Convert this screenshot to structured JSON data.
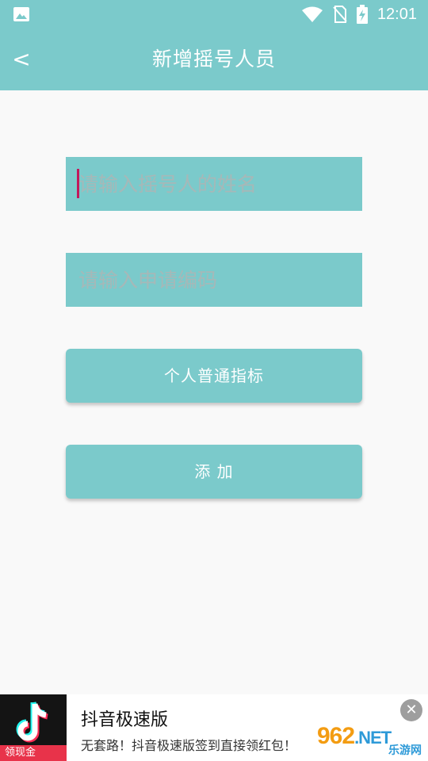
{
  "status_bar": {
    "time": "12:01",
    "icons": [
      "image-icon",
      "wifi-icon",
      "no-sim-icon",
      "battery-charging-icon"
    ]
  },
  "app_bar": {
    "back_label": "<",
    "title": "新增摇号人员"
  },
  "form": {
    "name_placeholder": "请输入摇号人的姓名",
    "code_placeholder": "请输入申请编码",
    "type_button": "个人普通指标",
    "add_button": "添 加"
  },
  "ad": {
    "title": "抖音极速版",
    "subtitle": "无套路！抖音极速版签到直接领红包！",
    "badge": "领现金",
    "close": "✕"
  },
  "watermark": {
    "main": "962",
    "suffix": ".NET",
    "sub": "乐游网"
  },
  "colors": {
    "accent": "#7bcacb",
    "caret": "#c2185b",
    "ad_badge": "#e8334a"
  }
}
